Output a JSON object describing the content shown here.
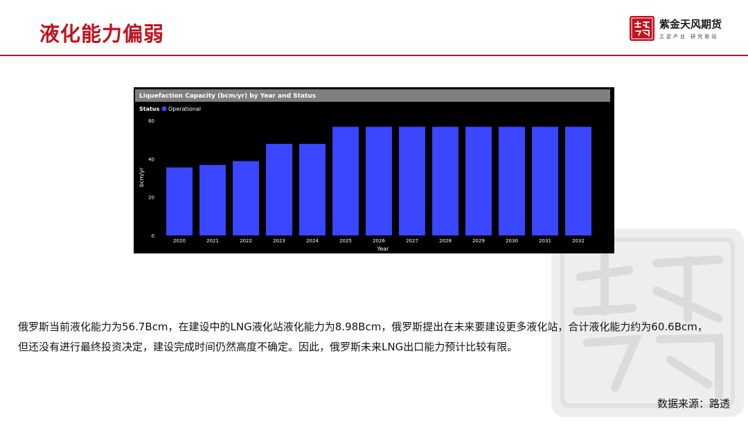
{
  "slide": {
    "title": "液化能力偏弱",
    "brand": {
      "name": "紫金天风期货",
      "slogan": "立足产业 研究驱动",
      "seal_text": "紫金天风"
    },
    "body": "俄罗斯当前液化能力为56.7Bcm，在建设中的LNG液化站液化能力为8.98Bcm，俄罗斯提出在未来要建设更多液化站，合计液化能力约为60.6Bcm，但还没有进行最终投资决定，建设完成时间仍然高度不确定。因此，俄罗斯未来LNG出口能力预计比较有限。",
    "source": "数据来源：路透",
    "accent_color": "#c0121f"
  },
  "chart_data": {
    "type": "bar",
    "title": "Liquefaction Capacity (bcm/yr) by Year and Status",
    "legend_title": "Status",
    "legend_position": "top-left",
    "xlabel": "Year",
    "ylabel": "bcm/yr",
    "ylim": [
      0,
      60
    ],
    "yticks": [
      0,
      20,
      40,
      60
    ],
    "grid": false,
    "categories": [
      "2020",
      "2021",
      "2022",
      "2023",
      "2024",
      "2025",
      "2026",
      "2027",
      "2028",
      "2029",
      "2030",
      "2031",
      "2032"
    ],
    "series": [
      {
        "name": "Operational",
        "color": "#3a46ff",
        "values": [
          35.5,
          36.8,
          38.8,
          47.8,
          47.8,
          56.7,
          56.7,
          56.7,
          56.7,
          56.7,
          56.7,
          56.7,
          56.7
        ]
      }
    ],
    "background": "#000000",
    "title_bar_color": "#7f7f7f"
  }
}
